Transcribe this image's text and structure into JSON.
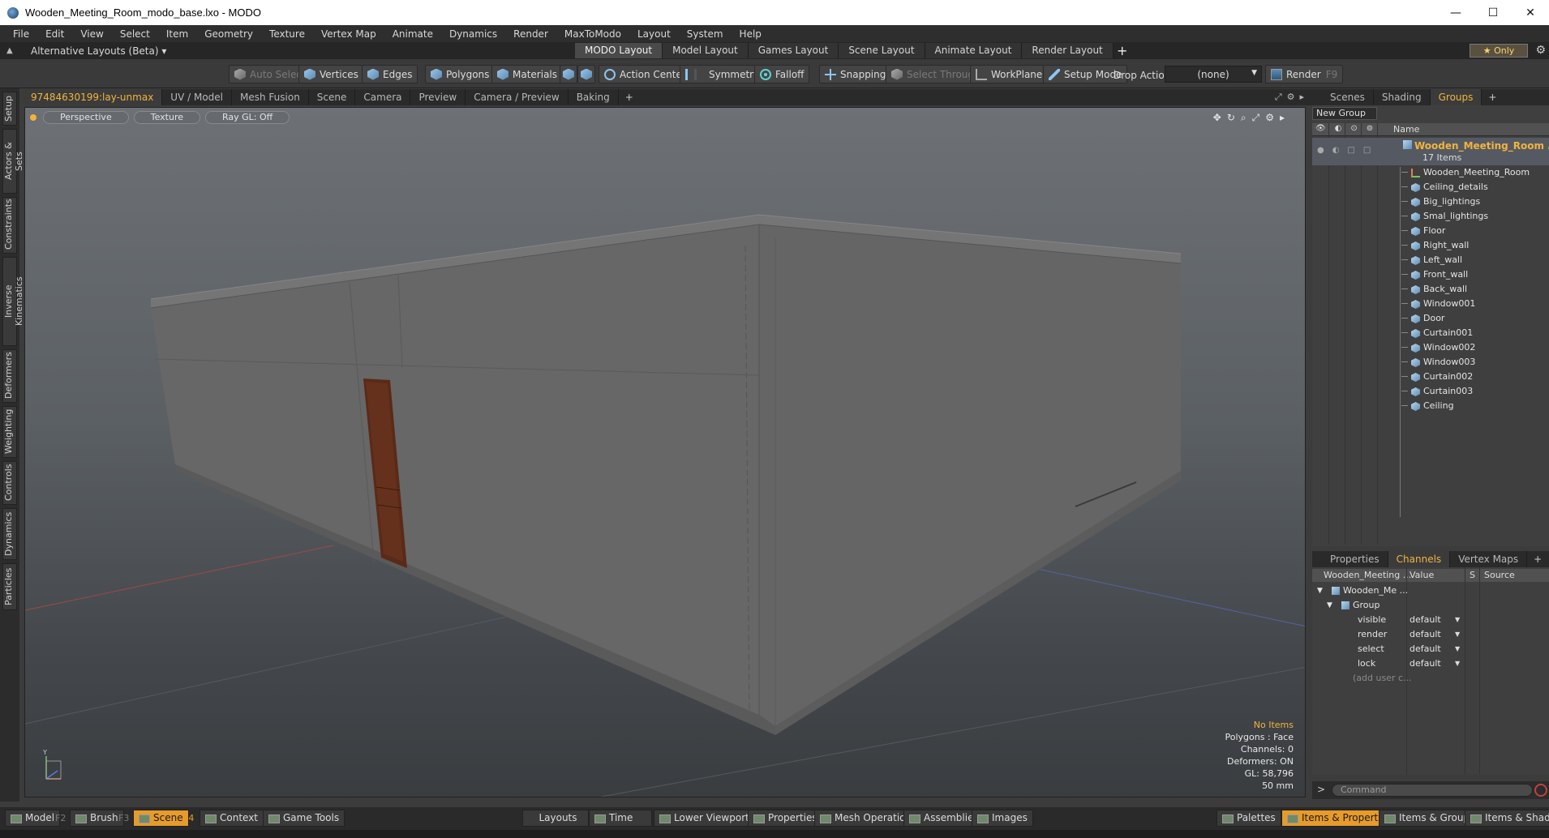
{
  "window": {
    "title": "Wooden_Meeting_Room_modo_base.lxo - MODO",
    "minimize": "—",
    "maximize": "☐",
    "close": "✕"
  },
  "menu": [
    "File",
    "Edit",
    "View",
    "Select",
    "Item",
    "Geometry",
    "Texture",
    "Vertex Map",
    "Animate",
    "Dynamics",
    "Render",
    "MaxToModo",
    "Layout",
    "System",
    "Help"
  ],
  "layout_bar": {
    "alt_layouts": "Alternative Layouts (Beta) ▾",
    "tabs": [
      "MODO Layout",
      "Model Layout",
      "Games Layout",
      "Scene Layout",
      "Animate Layout",
      "Render Layout"
    ],
    "active_tab": 0,
    "add": "+",
    "only": "★ Only"
  },
  "toolbar": {
    "auto_select": "Auto Select",
    "vertices": "Vertices",
    "edges": "Edges",
    "polygons": "Polygons",
    "materials": "Materials",
    "action_center": "Action Center",
    "symmetry": "Symmetry",
    "falloff": "Falloff",
    "snapping": "Snapping",
    "select_through": "Select Through",
    "workplane": "WorkPlane",
    "setup_mode": "Setup Mode",
    "drop_action": "Drop Action",
    "drop_value": "(none)",
    "render": "Render",
    "render_key": "F9"
  },
  "left_tabs": [
    "Setup",
    "Actors & Sets",
    "Constraints",
    "Inverse Kinematics",
    "Deformers",
    "Weighting",
    "Controls",
    "Dynamics",
    "Particles"
  ],
  "viewport_tabs": {
    "items": [
      "97484630199:lay-unmax",
      "UV / Model",
      "Mesh Fusion",
      "Scene",
      "Camera",
      "Preview",
      "Camera / Preview",
      "Baking"
    ],
    "active": 0,
    "add": "+"
  },
  "viewport": {
    "view": "Perspective",
    "shading": "Texture",
    "raygl": "Ray GL: Off",
    "info": {
      "items": "No Items",
      "polygons": "Polygons : Face",
      "channels": "Channels: 0",
      "deformers": "Deformers: ON",
      "gl": "GL: 58,796",
      "focal": "50 mm"
    },
    "axis_y": "Y"
  },
  "right_tabs": {
    "items": [
      "Scenes",
      "Shading",
      "Groups"
    ],
    "active": 2,
    "add": "+"
  },
  "groups": {
    "new_group": "New Group",
    "name_col": "Name",
    "root": {
      "name": "Wooden_Meeting_Room ...",
      "count": "17 Items"
    },
    "items": [
      {
        "name": "Wooden_Meeting_Room",
        "kind": "locator"
      },
      {
        "name": "Ceiling_details",
        "kind": "mesh"
      },
      {
        "name": "Big_lightings",
        "kind": "mesh"
      },
      {
        "name": "Smal_lightings",
        "kind": "mesh"
      },
      {
        "name": "Floor",
        "kind": "mesh"
      },
      {
        "name": "Right_wall",
        "kind": "mesh"
      },
      {
        "name": "Left_wall",
        "kind": "mesh"
      },
      {
        "name": "Front_wall",
        "kind": "mesh"
      },
      {
        "name": "Back_wall",
        "kind": "mesh"
      },
      {
        "name": "Window001",
        "kind": "mesh"
      },
      {
        "name": "Door",
        "kind": "mesh"
      },
      {
        "name": "Curtain001",
        "kind": "mesh"
      },
      {
        "name": "Window002",
        "kind": "mesh"
      },
      {
        "name": "Window003",
        "kind": "mesh"
      },
      {
        "name": "Curtain002",
        "kind": "mesh"
      },
      {
        "name": "Curtain003",
        "kind": "mesh"
      },
      {
        "name": "Ceiling",
        "kind": "mesh"
      }
    ]
  },
  "prop_tabs": {
    "items": [
      "Properties",
      "Channels",
      "Vertex Maps"
    ],
    "active": 1,
    "add": "+"
  },
  "channels": {
    "headers": {
      "name": "Wooden_Meeting ...",
      "value": "Value",
      "s": "S",
      "source": "Source"
    },
    "root": "Wooden_Me ...",
    "group": "Group",
    "rows": [
      {
        "label": "visible",
        "value": "default"
      },
      {
        "label": "render",
        "value": "default"
      },
      {
        "label": "select",
        "value": "default"
      },
      {
        "label": "lock",
        "value": "default"
      }
    ],
    "add_user": "(add user c..."
  },
  "command": {
    "prompt": ">",
    "placeholder": "Command"
  },
  "bottom_bar": {
    "model": "Model",
    "model_key": "F2",
    "brush": "Brush",
    "brush_key": "F3",
    "scene": "Scene",
    "scene_key": "F4",
    "context": "Context",
    "game_tools": "Game Tools",
    "layouts": "Layouts",
    "time": "Time",
    "lower_viewports": "Lower Viewports",
    "properties": "Properties",
    "mesh_operations": "Mesh Operations",
    "assemblies": "Assemblies",
    "images": "Images",
    "palettes": "Palettes",
    "items_properties": "Items & Properties",
    "items_groups": "Items & Groups",
    "items_shading": "Items & Shading"
  },
  "colors": {
    "accent": "#f3b33c",
    "active_button": "#e79b2a",
    "door_wood": "#5a2a17",
    "wall": "#6a6a6a"
  }
}
